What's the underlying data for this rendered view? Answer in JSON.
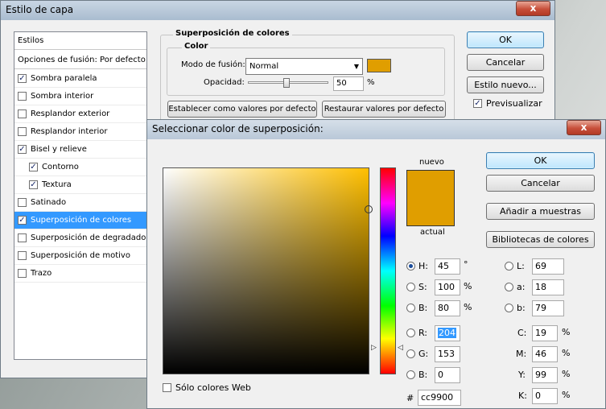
{
  "layer_style": {
    "title": "Estilo de capa",
    "close": "x",
    "styles_header": "Estilos",
    "blend_options": "Opciones de fusión: Por defecto",
    "items": [
      {
        "label": "Sombra paralela",
        "checked": true,
        "check": "✓"
      },
      {
        "label": "Sombra interior",
        "checked": false,
        "check": ""
      },
      {
        "label": "Resplandor exterior",
        "checked": false,
        "check": ""
      },
      {
        "label": "Resplandor interior",
        "checked": false,
        "check": ""
      },
      {
        "label": "Bisel y relieve",
        "checked": true,
        "check": "✓"
      },
      {
        "label": "Contorno",
        "checked": true,
        "check": "✓"
      },
      {
        "label": "Textura",
        "checked": true,
        "check": "✓"
      },
      {
        "label": "Satinado",
        "checked": false,
        "check": ""
      },
      {
        "label": "Superposición de colores",
        "checked": true,
        "check": "✓"
      },
      {
        "label": "Superposición de degradado",
        "checked": false,
        "check": ""
      },
      {
        "label": "Superposición de motivo",
        "checked": false,
        "check": ""
      },
      {
        "label": "Trazo",
        "checked": false,
        "check": ""
      }
    ],
    "overlay_group": "Superposición de colores",
    "color_group": "Color",
    "blend_mode_label": "Modo de fusión:",
    "blend_mode_value": "Normal",
    "overlay_color": "#e09e00",
    "opacity_label": "Opacidad:",
    "opacity_value": "50",
    "opacity_unit": "%",
    "opacity_level": 0.5,
    "set_default": "Establecer como valores por defecto",
    "reset_default": "Restaurar valores por defecto",
    "ok": "OK",
    "cancel": "Cancelar",
    "new_style": "Estilo nuevo...",
    "preview_label": "Previsualizar",
    "preview_check": "✓"
  },
  "picker": {
    "title": "Seleccionar color de superposición:",
    "close": "x",
    "new_label": "nuevo",
    "current_label": "actual",
    "new_color": "#e09e00",
    "current_color": "#e09e00",
    "field_hue_color": "#ffbf00",
    "ok": "OK",
    "cancel": "Cancelar",
    "add_swatches": "Añadir a muestras",
    "libraries": "Bibliotecas de colores",
    "web_only": "Sólo colores Web",
    "hsb": [
      {
        "label": "H:",
        "value": "45",
        "unit": "°",
        "selected": true
      },
      {
        "label": "S:",
        "value": "100",
        "unit": "%",
        "selected": false
      },
      {
        "label": "B:",
        "value": "80",
        "unit": "%",
        "selected": false
      }
    ],
    "rgb": [
      {
        "label": "R:",
        "value": "204",
        "selected": false
      },
      {
        "label": "G:",
        "value": "153",
        "selected": false
      },
      {
        "label": "B:",
        "value": "0",
        "selected": false
      }
    ],
    "lab": [
      {
        "label": "L:",
        "value": "69"
      },
      {
        "label": "a:",
        "value": "18"
      },
      {
        "label": "b:",
        "value": "79"
      }
    ],
    "cmyk": [
      {
        "label": "C:",
        "value": "19",
        "unit": "%"
      },
      {
        "label": "M:",
        "value": "46",
        "unit": "%"
      },
      {
        "label": "Y:",
        "value": "99",
        "unit": "%"
      },
      {
        "label": "K:",
        "value": "0",
        "unit": "%"
      }
    ],
    "hex_label": "#",
    "hex_value": "cc9900"
  }
}
